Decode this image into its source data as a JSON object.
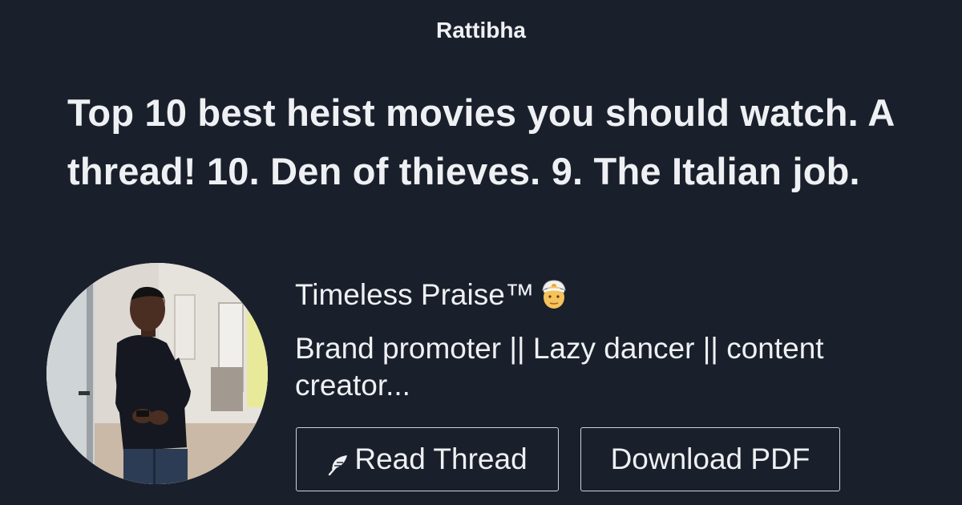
{
  "site": {
    "brand": "Rattibha"
  },
  "thread": {
    "headline": "Top 10 best heist movies you should watch. A thread! 10. Den of thieves. 9. The Italian job."
  },
  "author": {
    "name": "Timeless Praise™",
    "emoji": "man-with-turban-emoji",
    "bio": "Brand promoter || Lazy dancer || content creator..."
  },
  "actions": {
    "read_label": "Read Thread",
    "read_icon": "feather-icon",
    "pdf_label": "Download PDF"
  },
  "colors": {
    "background": "#1a202b",
    "text": "#eef0f3",
    "button_border": "#cdd3db"
  }
}
